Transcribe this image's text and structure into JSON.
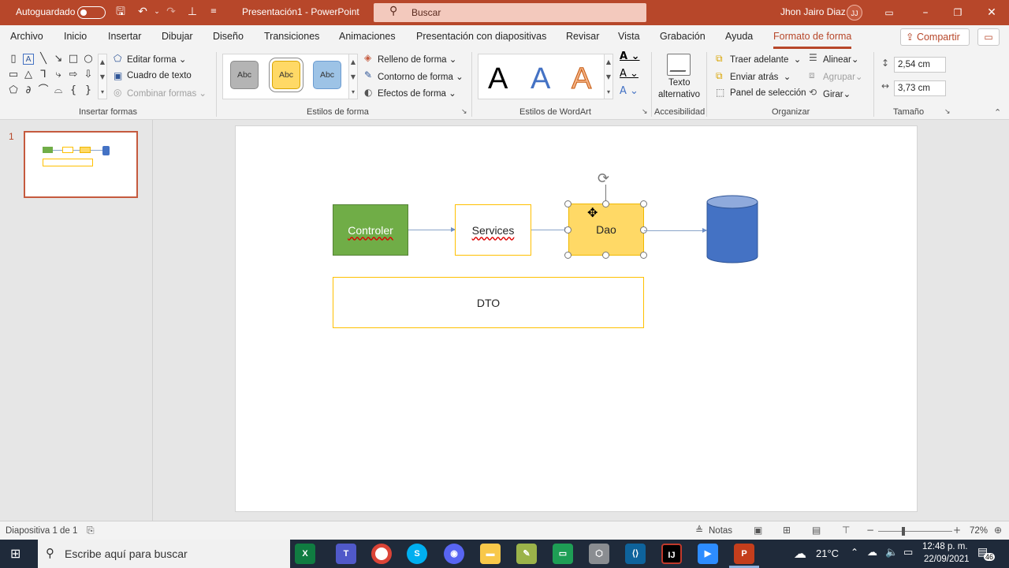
{
  "titlebar": {
    "autosave_label": "Autoguardado",
    "doc_title": "Presentación1  -  PowerPoint",
    "search_placeholder": "Buscar",
    "user_name": "Jhon Jairo Diaz",
    "user_initials": "JJ",
    "accent_color": "#b7472a"
  },
  "tabs": [
    "Archivo",
    "Inicio",
    "Insertar",
    "Dibujar",
    "Diseño",
    "Transiciones",
    "Animaciones",
    "Presentación con diapositivas",
    "Revisar",
    "Vista",
    "Grabación",
    "Ayuda",
    "Formato de forma"
  ],
  "active_tab": "Formato de forma",
  "share_label": "Compartir",
  "ribbon": {
    "insert_shapes": {
      "label": "Insertar formas",
      "edit_shape": "Editar forma",
      "text_box": "Cuadro de texto",
      "merge_shapes": "Combinar formas"
    },
    "shape_styles": {
      "label": "Estilos de forma",
      "swatch_text": "Abc",
      "fill": "Relleno de forma",
      "outline": "Contorno de forma",
      "effects": "Efectos de forma"
    },
    "wordart": {
      "label": "Estilos de WordArt",
      "letter": "A"
    },
    "accessibility": {
      "label": "Accesibilidad",
      "alt_text_1": "Texto",
      "alt_text_2": "alternativo"
    },
    "arrange": {
      "label": "Organizar",
      "bring_forward": "Traer adelante",
      "send_backward": "Enviar atrás",
      "selection_pane": "Panel de selección",
      "align": "Alinear",
      "group": "Agrupar",
      "rotate": "Girar"
    },
    "size": {
      "label": "Tamaño",
      "height": "2,54 cm",
      "width": "3,73 cm"
    }
  },
  "thumbnails": [
    {
      "number": "1"
    }
  ],
  "slide": {
    "controller_label": "Controler",
    "services_label": "Services",
    "dao_label": "Dao",
    "dto_label": "DTO"
  },
  "status": {
    "slide_counter": "Diapositiva 1 de 1",
    "notes_label": "Notas",
    "zoom": "72%",
    "zoom_level": 0.72
  },
  "taskbar": {
    "search_placeholder": "Escribe aquí para buscar",
    "temperature": "21°C",
    "time": "12:48 p. m.",
    "date": "22/09/2021",
    "notifications": "46"
  }
}
